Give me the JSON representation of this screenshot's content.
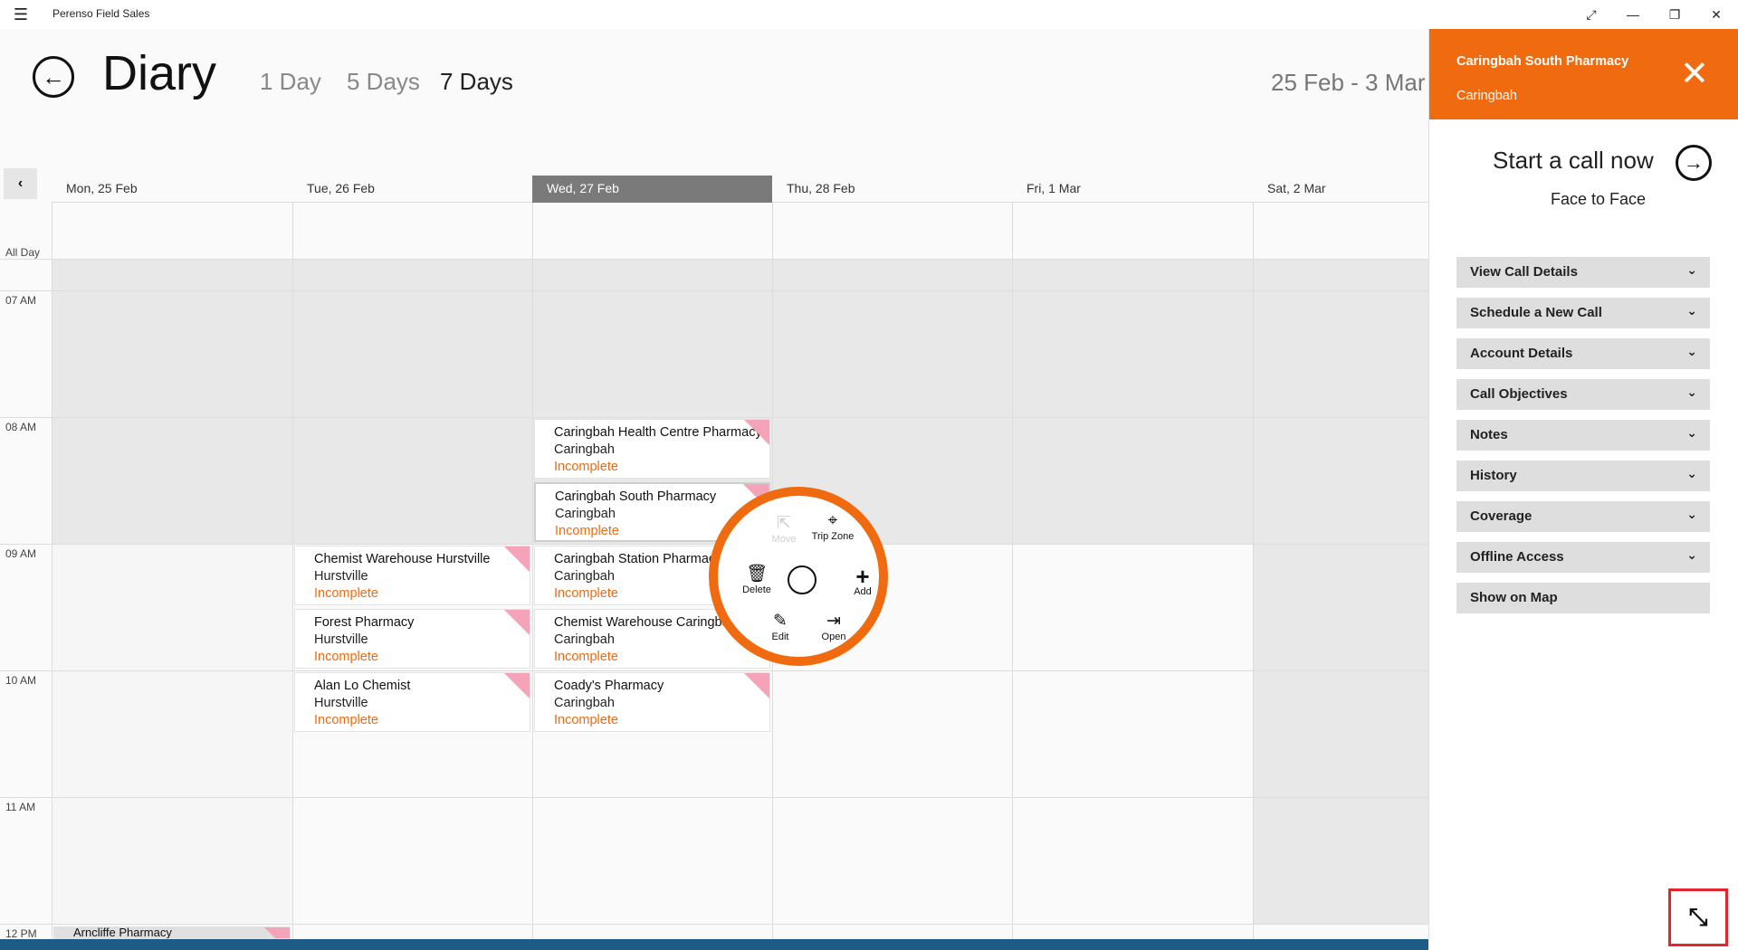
{
  "app": {
    "title": "Perenso Field Sales"
  },
  "header": {
    "title": "Diary",
    "tabs": [
      "1 Day",
      "5 Days",
      "7 Days"
    ],
    "active_tab": "7 Days",
    "date_range": "25 Feb - 3 Mar"
  },
  "calendar": {
    "all_day_label": "All Day",
    "days": [
      "Mon, 25 Feb",
      "Tue, 26 Feb",
      "Wed, 27 Feb",
      "Thu, 28 Feb",
      "Fri, 1 Mar",
      "Sat, 2 Mar"
    ],
    "active_day": "Wed, 27 Feb",
    "hours": [
      "07 AM",
      "08 AM",
      "09 AM",
      "10 AM",
      "11 AM",
      "12 PM"
    ],
    "appointments": [
      {
        "name": "Caringbah Health Centre Pharmacy",
        "city": "Caringbah",
        "status": "Incomplete",
        "type": "Face to Face"
      },
      {
        "name": "Caringbah South Pharmacy",
        "city": "Caringbah",
        "status": "Incomplete",
        "type": "Face to Face"
      },
      {
        "name": "Caringbah Station Pharmacy",
        "city": "Caringbah",
        "status": "Incomplete",
        "type": "Face to Face"
      },
      {
        "name": "Chemist Warehouse Caringbah",
        "city": "Caringbah",
        "status": "Incomplete",
        "type": "Face to Face"
      },
      {
        "name": "Coady's Pharmacy",
        "city": "Caringbah",
        "status": "Incomplete",
        "type": "Face to Face"
      },
      {
        "name": "Chemist Warehouse Hurstville",
        "city": "Hurstville",
        "status": "Incomplete",
        "type": "Face to Face"
      },
      {
        "name": "Forest Pharmacy",
        "city": "Hurstville",
        "status": "Incomplete",
        "type": "Face to Face"
      },
      {
        "name": "Alan Lo Chemist",
        "city": "Hurstville",
        "status": "Incomplete",
        "type": "Face to Face"
      },
      {
        "name": "Arncliffe Pharmacy",
        "city": "",
        "status": "",
        "type": ""
      }
    ]
  },
  "radial_menu": {
    "move": "Move",
    "trip_zone": "Trip Zone",
    "delete": "Delete",
    "add": "Add",
    "edit": "Edit",
    "open": "Open"
  },
  "side_panel": {
    "account_name": "Caringbah South Pharmacy",
    "account_city": "Caringbah",
    "start_call": "Start a call now",
    "call_type": "Face to Face",
    "sections": [
      "View Call Details",
      "Schedule a New Call",
      "Account Details",
      "Call Objectives",
      "Notes",
      "History",
      "Coverage",
      "Offline Access",
      "Show on Map"
    ]
  },
  "colors": {
    "accent": "#f06a0f",
    "status_bar": "#1e5b87",
    "highlight_border": "#e3262b"
  }
}
